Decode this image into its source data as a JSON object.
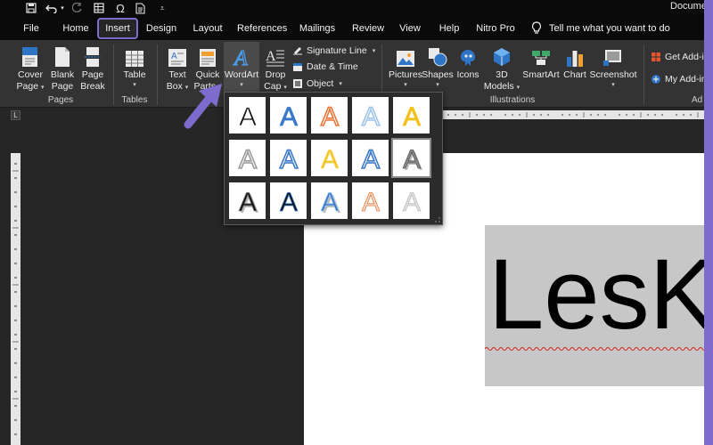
{
  "title_bar": {
    "document_title": "Docume",
    "qat_icons": [
      "save-icon",
      "undo-icon",
      "undo-dropdown-icon",
      "redo-icon",
      "table-icon",
      "omega-icon",
      "document-icon",
      "customize-icon"
    ]
  },
  "tabs": [
    {
      "label": "File",
      "active": false
    },
    {
      "label": "Home",
      "active": false
    },
    {
      "label": "Insert",
      "active": true
    },
    {
      "label": "Design",
      "active": false
    },
    {
      "label": "Layout",
      "active": false
    },
    {
      "label": "References",
      "active": false
    },
    {
      "label": "Mailings",
      "active": false
    },
    {
      "label": "Review",
      "active": false
    },
    {
      "label": "View",
      "active": false
    },
    {
      "label": "Help",
      "active": false
    },
    {
      "label": "Nitro Pro",
      "active": false
    }
  ],
  "tell_me": "Tell me what you want to do",
  "ribbon": {
    "pages": {
      "group_label": "Pages",
      "cover_page": [
        "Cover",
        "Page"
      ],
      "blank_page": [
        "Blank",
        "Page"
      ],
      "page_break": [
        "Page",
        "Break"
      ]
    },
    "tables": {
      "group_label": "Tables",
      "table": "Table"
    },
    "text": {
      "text_box": [
        "Text",
        "Box"
      ],
      "quick_parts": [
        "Quick",
        "Parts"
      ],
      "wordart": "WordArt",
      "drop_cap": [
        "Drop",
        "Cap"
      ],
      "signature_line": "Signature Line",
      "date_time": "Date & Time",
      "object": "Object"
    },
    "illustrations": {
      "group_label": "Illustrations",
      "pictures": "Pictures",
      "shapes": "Shapes",
      "icons": "Icons",
      "models_3d": [
        "3D",
        "Models"
      ],
      "smartart": "SmartArt",
      "chart": "Chart",
      "screenshot": "Screenshot"
    },
    "addins": {
      "group_label": "Ad",
      "get_addins": "Get Add-i",
      "my_addins": "My Add-in"
    }
  },
  "ruler_corner": "L",
  "document": {
    "text": "LesK"
  },
  "wordart_gallery": {
    "letter": "A",
    "styles": [
      {
        "fill": "#111111",
        "stroke": "#ffffff",
        "effect": "plain-black"
      },
      {
        "fill": "#3a78c8",
        "stroke": "#3a78c8",
        "effect": "blue-fill"
      },
      {
        "fill": "#ffffff",
        "stroke": "#e8773a",
        "effect": "orange-outline"
      },
      {
        "fill": "#ffffff",
        "stroke": "#9ec6ea",
        "effect": "light-blue-outline"
      },
      {
        "fill": "#f3c21a",
        "stroke": "#f3c21a",
        "effect": "gold-fill"
      },
      {
        "fill": "#ffffff",
        "stroke": "#9a9a9a",
        "effect": "gray-outline"
      },
      {
        "fill": "#ffffff",
        "stroke": "#3a78c8",
        "effect": "blue-gradient-outline"
      },
      {
        "fill": "#f3c21a",
        "stroke": "#f7dc6c",
        "effect": "gold-shine"
      },
      {
        "fill": "#ffffff",
        "stroke": "#3a78c8",
        "effect": "blue-outline"
      },
      {
        "fill": "#8a8a8a",
        "stroke": "#555555",
        "effect": "gray-bevel"
      },
      {
        "fill": "#111111",
        "stroke": "#777777",
        "effect": "black-shadow"
      },
      {
        "fill": "#111111",
        "stroke": "#3a78c8",
        "effect": "black-blue-outline"
      },
      {
        "fill": "#3a78c8",
        "stroke": "#9ec6ea",
        "effect": "blue-reflection"
      },
      {
        "fill": "#f0dfd2",
        "stroke": "#e8773a",
        "effect": "orange-gradient"
      },
      {
        "fill": "#e0e0e0",
        "stroke": "#bdbdbd",
        "effect": "silver"
      }
    ]
  },
  "colors": {
    "accent": "#7d6ccd",
    "titlebar_bg": "#0a0a0a",
    "ribbon_bg": "#333333",
    "workspace_bg": "#262626",
    "textbox_bg": "#c7c7c7"
  }
}
